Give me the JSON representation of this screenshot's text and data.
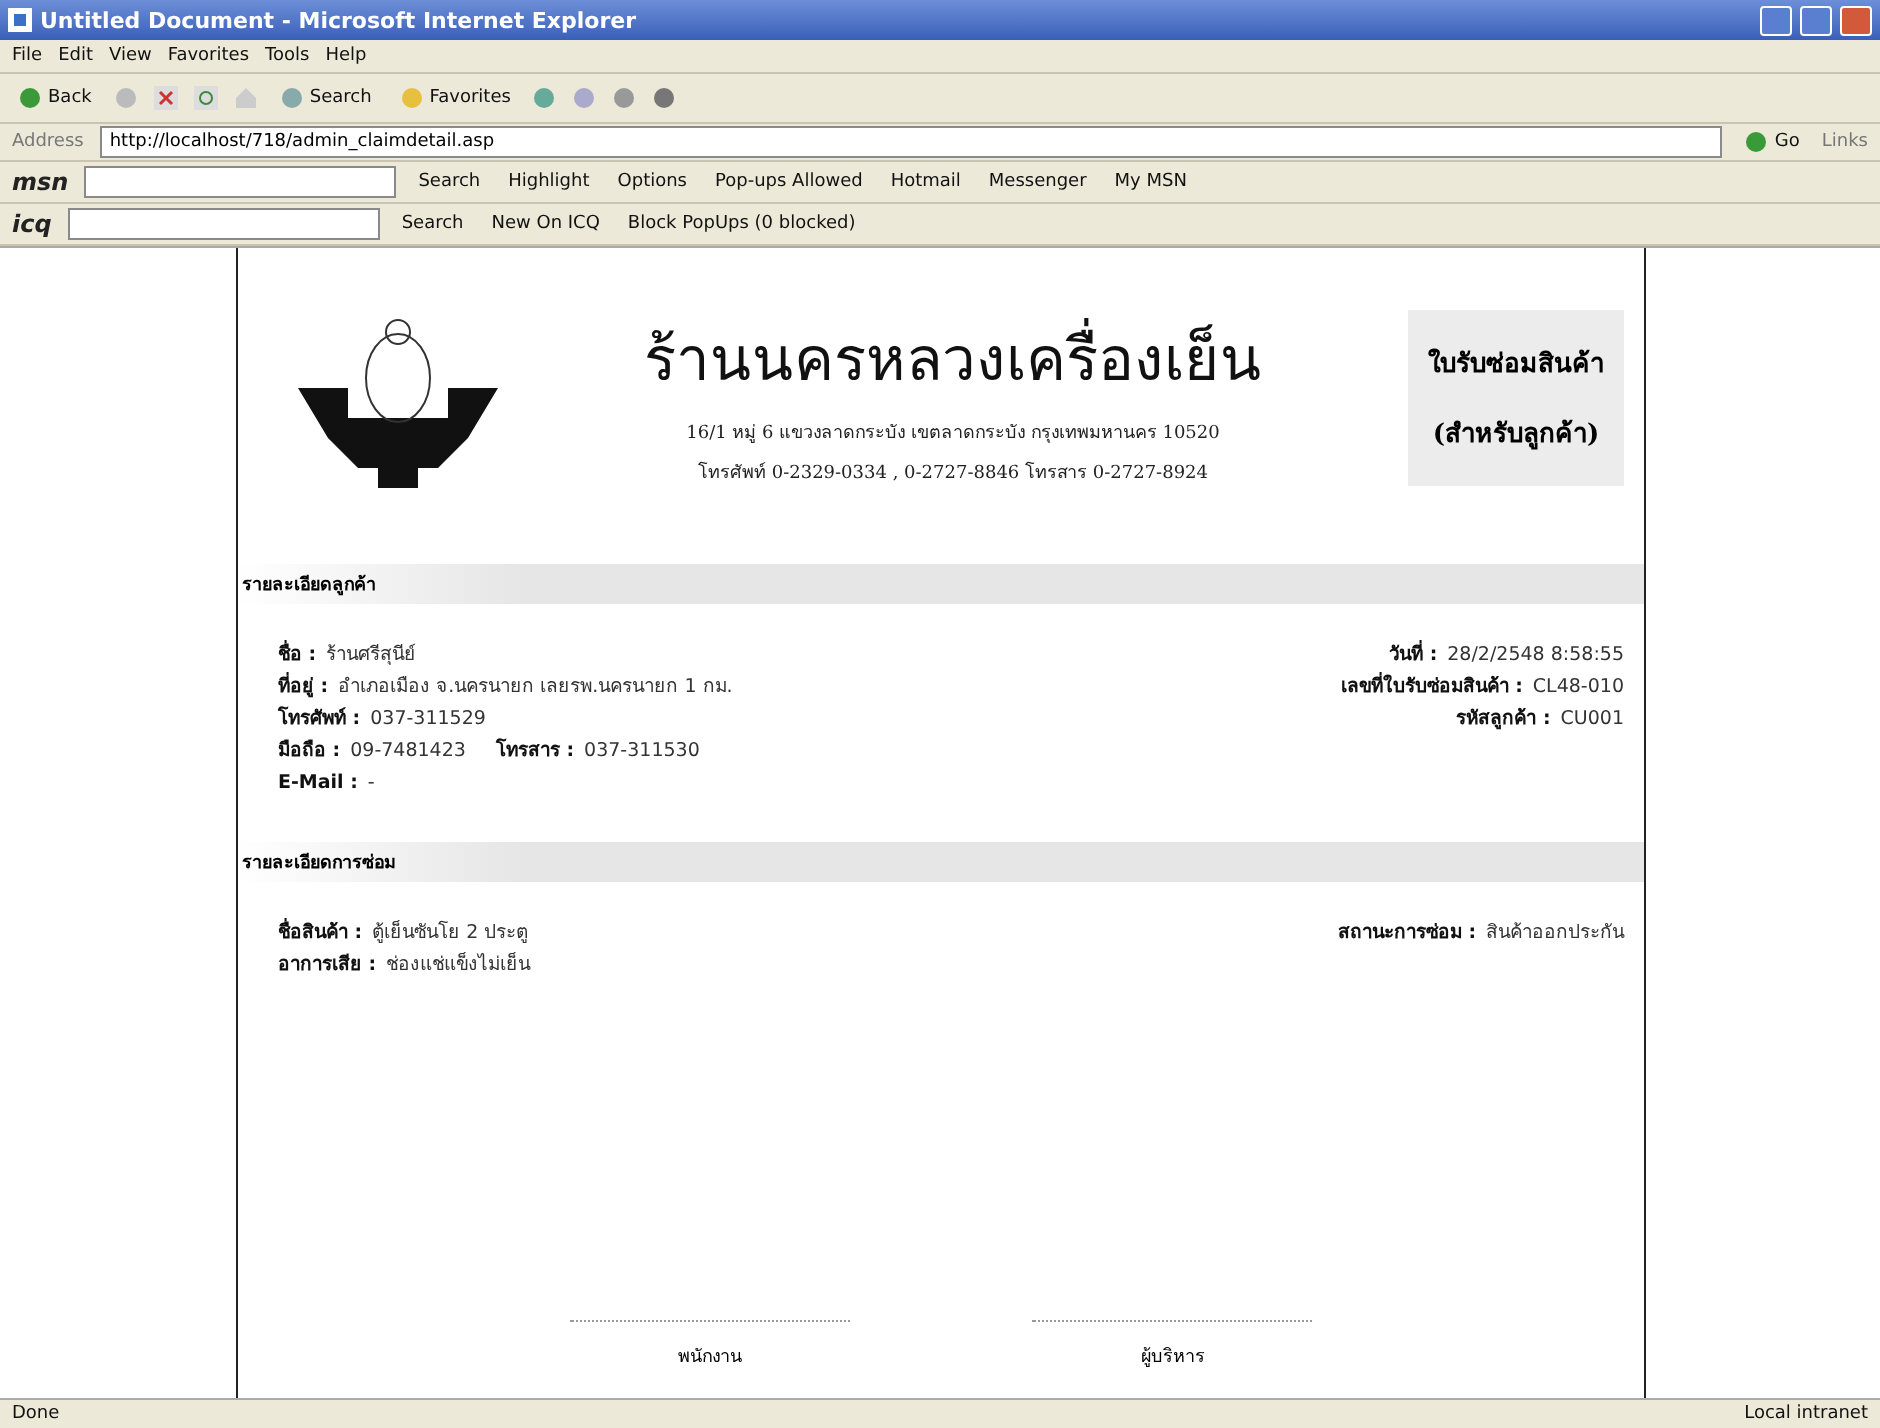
{
  "window": {
    "title": "Untitled Document - Microsoft Internet Explorer"
  },
  "menu": [
    "File",
    "Edit",
    "View",
    "Favorites",
    "Tools",
    "Help"
  ],
  "toolbar": {
    "back": "Back",
    "search": "Search",
    "favorites": "Favorites"
  },
  "address": {
    "label": "Address",
    "value": "http://localhost/718/admin_claimdetail.asp",
    "go": "Go",
    "links": "Links"
  },
  "msn_toolbar": {
    "logo": "msn",
    "items": [
      "Search",
      "Highlight",
      "Options",
      "Pop-ups Allowed",
      "Hotmail",
      "Messenger",
      "My MSN"
    ]
  },
  "icq_toolbar": {
    "logo": "icq",
    "items": [
      "Search",
      "New On ICQ",
      "Block PopUps (0 blocked)"
    ]
  },
  "document": {
    "shop_name": "ร้านนครหลวงเครื่องเย็น",
    "address": "16/1 หมู่ 6 แขวงลาดกระบัง เขตลาดกระบัง กรุงเทพมหานคร 10520",
    "phones": "โทรศัพท์ 0-2329-0334 , 0-2727-8846 โทรสาร 0-2727-8924",
    "form_title": [
      "ใบรับซ่อมสินค้า",
      "(สำหรับลูกค้า)"
    ],
    "sections": [
      {
        "title": "รายละเอียดลูกค้า",
        "left": [
          {
            "label": "ชื่อ :",
            "value": "ร้านศรีสุนีย์"
          },
          {
            "label": "ที่อยู่ :",
            "value": "อำเภอเมือง จ.นครนายก เลยรพ.นครนายก 1 กม."
          },
          {
            "label": "โทรศัพท์ :",
            "value": "037-311529"
          },
          {
            "label": "มือถือ :",
            "value": "09-7481423",
            "extra_label": "โทรสาร :",
            "extra_value": "037-311530"
          },
          {
            "label": "E-Mail :",
            "value": "-"
          }
        ],
        "right": [
          {
            "label": "วันที่ :",
            "value": "28/2/2548 8:58:55"
          },
          {
            "label": "เลขที่ใบรับซ่อมสินค้า :",
            "value": "CL48-010"
          },
          {
            "label": "รหัสลูกค้า :",
            "value": "CU001"
          }
        ]
      },
      {
        "title": "รายละเอียดการซ่อม",
        "left": [
          {
            "label": "ชื่อสินค้า :",
            "value": "ตู้เย็นซันโย 2 ประตู"
          },
          {
            "label": "อาการเสีย :",
            "value": "ช่องแช่แข็งไม่เย็น"
          }
        ],
        "right": [
          {
            "label": "สถานะการซ่อม :",
            "value": "สินค้าออกประกัน"
          }
        ]
      }
    ],
    "signatures": [
      "พนักงาน",
      "ผู้บริหาร"
    ]
  },
  "status_bar": {
    "left": "Done",
    "right": "Local intranet"
  }
}
